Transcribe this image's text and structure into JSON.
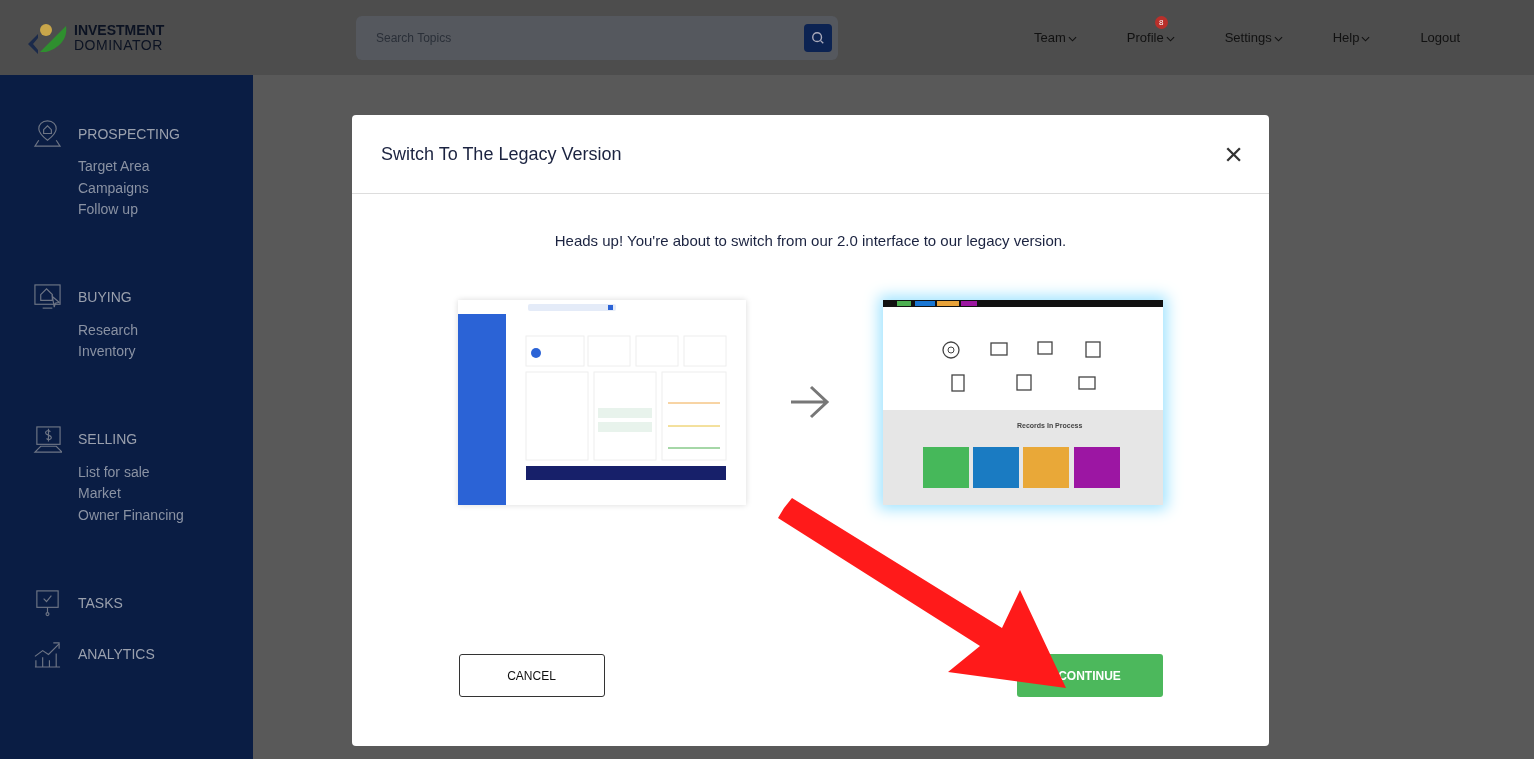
{
  "header": {
    "logo": {
      "line1": "INVESTMENT",
      "line2": "DOMINATOR"
    },
    "search": {
      "placeholder": "Search Topics"
    },
    "nav": [
      {
        "label": "Team",
        "dropdown": true
      },
      {
        "label": "Profile",
        "dropdown": true,
        "badge": "8"
      },
      {
        "label": "Settings",
        "dropdown": true
      },
      {
        "label": "Help",
        "dropdown": true
      },
      {
        "label": "Logout",
        "dropdown": false
      }
    ]
  },
  "sidebar": {
    "sections": [
      {
        "title": "PROSPECTING",
        "items": [
          "Target Area",
          "Campaigns",
          "Follow up"
        ]
      },
      {
        "title": "BUYING",
        "items": [
          "Research",
          "Inventory"
        ]
      },
      {
        "title": "SELLING",
        "items": [
          "List for sale",
          "Market",
          "Owner Financing"
        ]
      },
      {
        "title": "TASKS"
      },
      {
        "title": "ANALYTICS"
      }
    ]
  },
  "modal": {
    "title": "Switch To The Legacy Version",
    "close": "×",
    "message": "Heads up! You're about to switch from our 2.0 interface to our legacy version.",
    "legacy_preview": {
      "heading": "Records In Process"
    },
    "buttons": [
      {
        "label": "CANCEL",
        "kind": "outline"
      },
      {
        "label": "CONTINUE",
        "kind": "primary"
      }
    ]
  }
}
